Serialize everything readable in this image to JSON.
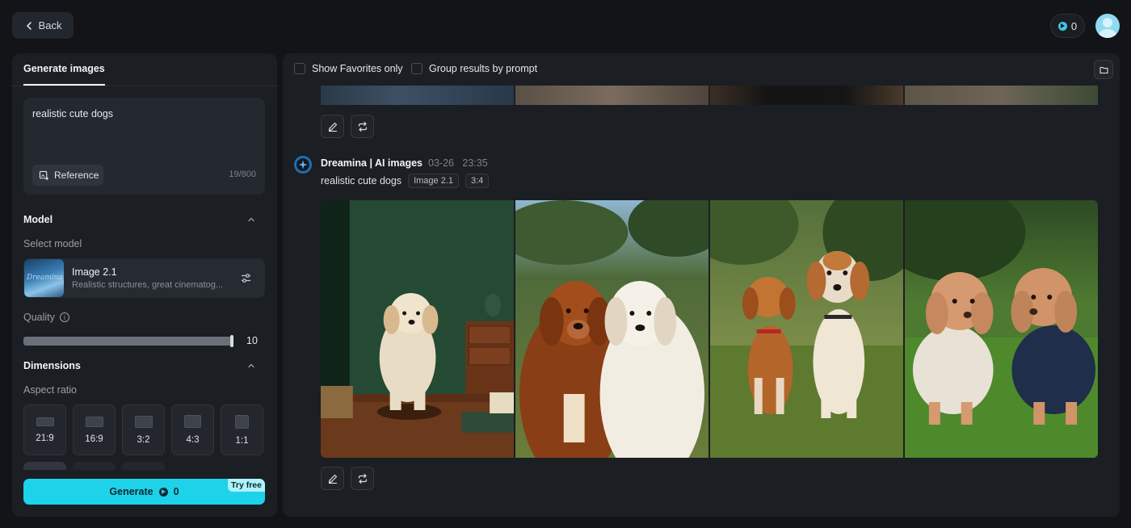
{
  "header": {
    "back_label": "Back",
    "credits": "0"
  },
  "left_panel": {
    "tab": "Generate images",
    "prompt": {
      "value": "realistic cute dogs",
      "reference_label": "Reference",
      "char_count": "19/800"
    },
    "model": {
      "section_title": "Model",
      "select_label": "Select model",
      "name": "Image 2.1",
      "description": "Realistic structures, great cinematog...",
      "thumb_text": "Dreamina"
    },
    "quality": {
      "label": "Quality",
      "info_glyph": "i",
      "value": "10",
      "fraction": 1.0
    },
    "dimensions": {
      "section_title": "Dimensions",
      "aspect_label": "Aspect ratio",
      "ratios": [
        {
          "label": "21:9"
        },
        {
          "label": "16:9"
        },
        {
          "label": "3:2"
        },
        {
          "label": "4:3"
        },
        {
          "label": "1:1"
        }
      ]
    },
    "generate": {
      "label": "Generate",
      "cost": "0",
      "badge": "Try free"
    }
  },
  "right_panel": {
    "filters": {
      "favorites_label": "Show Favorites only",
      "group_label": "Group results by prompt"
    },
    "generation": {
      "author": "Dreamina | AI images",
      "timestamp": "03-26   23:35",
      "prompt": "realistic cute dogs",
      "tags": [
        "Image 2.1",
        "3:4"
      ],
      "image_count": 4
    }
  },
  "colors": {
    "accent": "#1ed2ea",
    "background": "#121418",
    "panel": "#1b1e23"
  }
}
